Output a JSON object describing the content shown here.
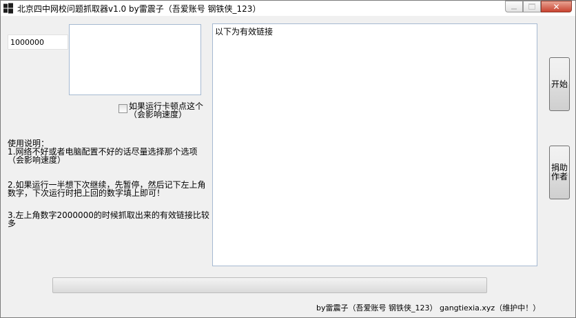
{
  "window": {
    "title": "北京四中网校问题抓取器v1.0  by雷震子（吾爱账号  钢铁侠_123）",
    "minimize_icon": "minimize-icon",
    "maximize_icon": "maximize-icon",
    "close_icon": "close-icon",
    "close_glyph": "✕"
  },
  "left_panel": {
    "number_value": "1000000",
    "checkbox": {
      "label": "如果运行卡顿点这个（会影响速度）",
      "checked": false
    },
    "instructions": {
      "heading": "使用说明：",
      "item1": "1.网络不好或者电脑配置不好的话尽量选择那个选项（会影响速度）",
      "item2": "2.如果运行一半想下次继续，先暂停，然后记下左上角数字，下次运行时把上回的数字填上即可！",
      "item3": "3.左上角数字2000000的时候抓取出来的有效链接比较多"
    }
  },
  "result_area": {
    "text": "以下为有效链接"
  },
  "buttons": {
    "start": "开始",
    "donate": "捐助作者"
  },
  "progress": {
    "value": 0
  },
  "footer": {
    "text": "by雷震子（吾爱账号  钢铁侠_123）   gangtiexia.xyz（维护中！）"
  },
  "colors": {
    "input_border": "#a5b9d1",
    "close_red": "#c94330",
    "background": "#f0f0f0"
  }
}
